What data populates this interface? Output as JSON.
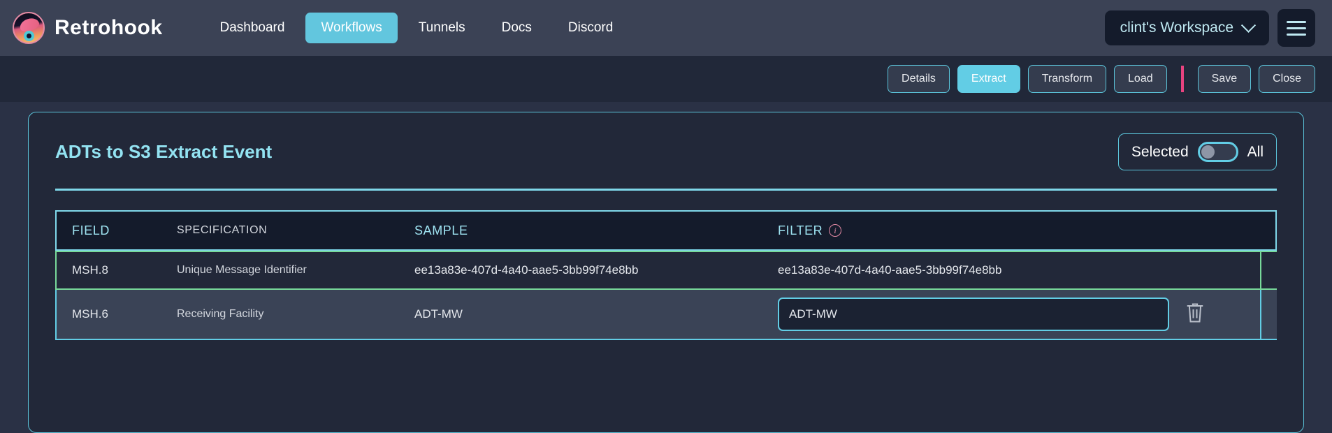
{
  "brand": {
    "name": "Retrohook",
    "logo_icon": "retrohook-logo-icon"
  },
  "nav": {
    "items": [
      {
        "label": "Dashboard",
        "active": false
      },
      {
        "label": "Workflows",
        "active": true
      },
      {
        "label": "Tunnels",
        "active": false
      },
      {
        "label": "Docs",
        "active": false
      },
      {
        "label": "Discord",
        "active": false
      }
    ],
    "workspace": {
      "label": "clint's Workspace",
      "chevron_icon": "chevron-down-icon"
    },
    "menu_icon": "hamburger-menu-icon"
  },
  "toolbar": {
    "buttons": [
      {
        "label": "Details",
        "active": false
      },
      {
        "label": "Extract",
        "active": true
      },
      {
        "label": "Transform",
        "active": false
      },
      {
        "label": "Load",
        "active": false
      }
    ],
    "separator_color": "#e8437f",
    "actions": [
      {
        "label": "Save"
      },
      {
        "label": "Close"
      }
    ]
  },
  "card": {
    "title": "ADTs to S3 Extract Event",
    "toggle": {
      "left_label": "Selected",
      "right_label": "All",
      "state": "selected"
    },
    "table": {
      "columns": [
        {
          "label": "FIELD"
        },
        {
          "label": "SPECIFICATION"
        },
        {
          "label": "SAMPLE"
        },
        {
          "label": "FILTER",
          "icon": "info-icon"
        }
      ],
      "rows": [
        {
          "field": "MSH.8",
          "specification": "Unique Message Identifier",
          "sample": "ee13a83e-407d-4a40-aae5-3bb99f74e8bb",
          "filter_value": "ee13a83e-407d-4a40-aae5-3bb99f74e8bb",
          "editing": false,
          "accent": "#78d99a"
        },
        {
          "field": "MSH.6",
          "specification": "Receiving Facility",
          "sample": "ADT-MW",
          "filter_value": "ADT-MW",
          "editing": true,
          "accent": "#62cde5",
          "delete_icon": "trash-icon"
        }
      ]
    }
  },
  "colors": {
    "accent_cyan": "#62cde5",
    "accent_green": "#78d99a",
    "accent_pink": "#e8437f",
    "nav_bg": "#3b4255",
    "page_bg": "#2a3145",
    "card_bg": "#222839"
  }
}
